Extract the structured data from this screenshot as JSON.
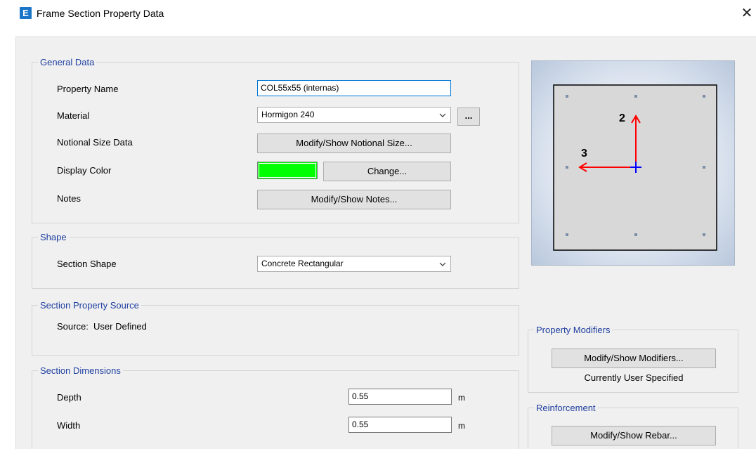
{
  "window": {
    "title": "Frame Section Property Data",
    "app_icon_letter": "E",
    "close_glyph": "✕"
  },
  "general_data": {
    "title": "General Data",
    "property_name_label": "Property Name",
    "property_name_value": "COL55x55 (internas)",
    "material_label": "Material",
    "material_value": "Hormigon 240",
    "material_more_label": "...",
    "notional_label": "Notional Size Data",
    "notional_button": "Modify/Show Notional Size...",
    "display_color_label": "Display Color",
    "display_color_value": "#00ff00",
    "change_button": "Change...",
    "notes_label": "Notes",
    "notes_button": "Modify/Show Notes..."
  },
  "shape": {
    "title": "Shape",
    "section_shape_label": "Section Shape",
    "section_shape_value": "Concrete Rectangular"
  },
  "source": {
    "title": "Section Property Source",
    "source_text": "Source:  User Defined"
  },
  "dimensions": {
    "title": "Section Dimensions",
    "depth_label": "Depth",
    "depth_value": "0.55",
    "depth_unit": "m",
    "width_label": "Width",
    "width_value": "0.55",
    "width_unit": "m"
  },
  "preview": {
    "axis_2_label": "2",
    "axis_3_label": "3"
  },
  "property_modifiers": {
    "title": "Property Modifiers",
    "button": "Modify/Show Modifiers...",
    "status": "Currently User Specified"
  },
  "reinforcement": {
    "title": "Reinforcement",
    "button": "Modify/Show Rebar..."
  }
}
